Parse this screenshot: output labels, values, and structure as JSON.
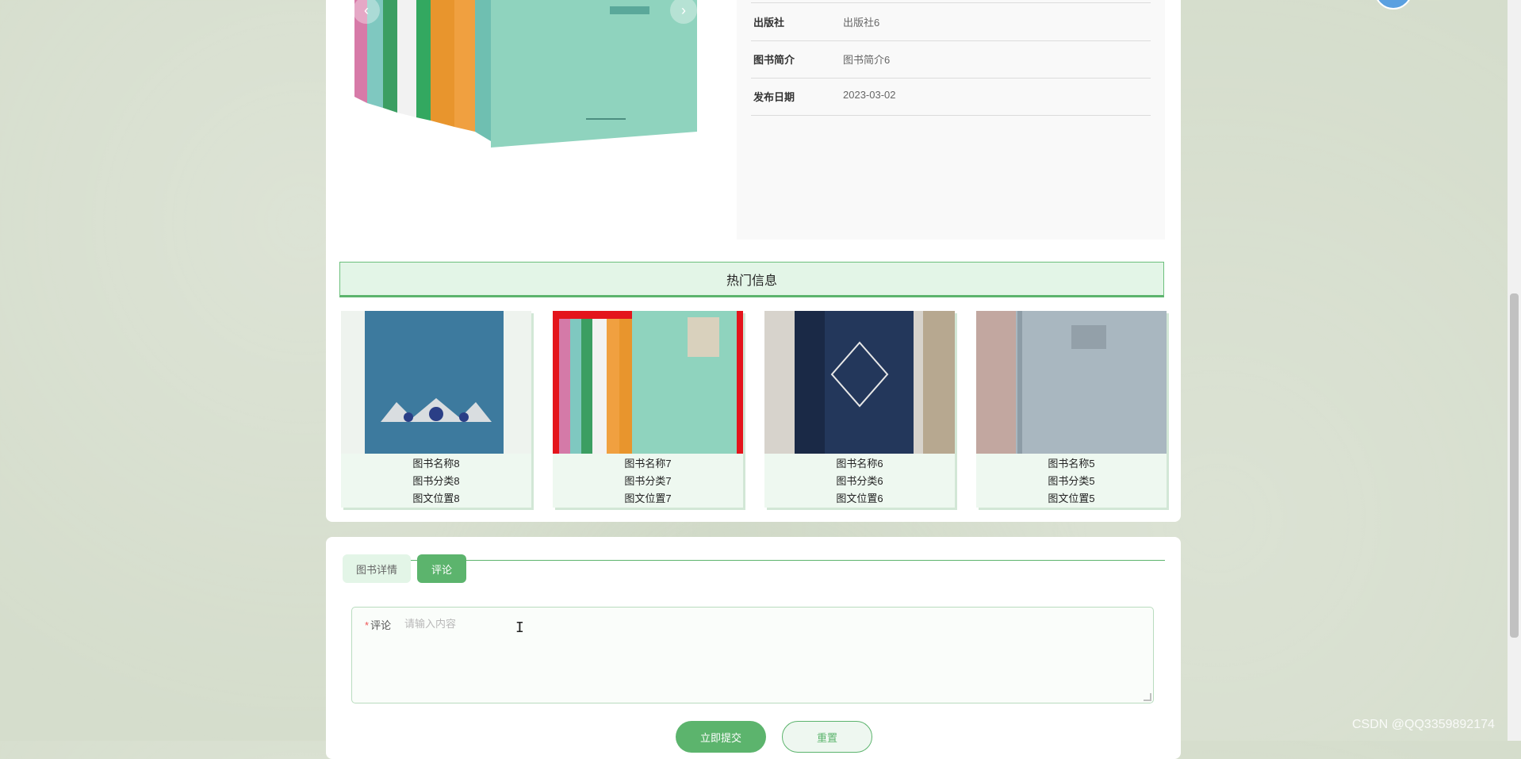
{
  "info": {
    "rows": [
      {
        "key": "出版社",
        "value": "出版社6"
      },
      {
        "key": "图书简介",
        "value": "图书简介6"
      },
      {
        "key": "发布日期",
        "value": "2023-03-02"
      }
    ]
  },
  "carousel": {
    "prev_icon": "‹",
    "next_icon": "›"
  },
  "hot": {
    "title": "热门信息",
    "items": [
      {
        "name": "图书名称8",
        "category": "图书分类8",
        "location": "图文位置8"
      },
      {
        "name": "图书名称7",
        "category": "图书分类7",
        "location": "图文位置7"
      },
      {
        "name": "图书名称6",
        "category": "图书分类6",
        "location": "图文位置6"
      },
      {
        "name": "图书名称5",
        "category": "图书分类5",
        "location": "图文位置5"
      }
    ]
  },
  "tabs": {
    "detail": "图书详情",
    "comment": "评论"
  },
  "comment_form": {
    "label": "评论",
    "required_mark": "*",
    "placeholder": "请输入内容",
    "submit": "立即提交",
    "reset": "重置"
  },
  "watermark": "CSDN @QQ3359892174",
  "colors": {
    "accent": "#5cb46d",
    "accent_light": "#e3f5e7",
    "page_bg": "#d5ddcc"
  }
}
